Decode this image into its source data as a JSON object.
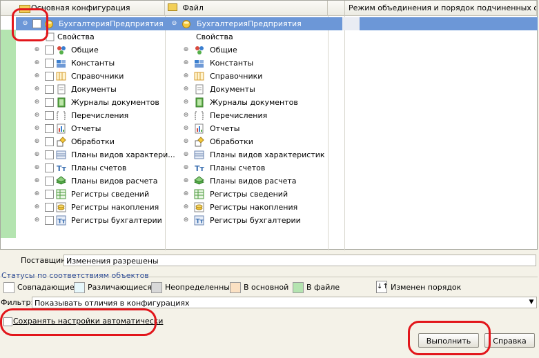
{
  "columns": {
    "main": "Основная конфигурация",
    "file": "Файл",
    "mode": "Режим объединения и порядок подчиненных объе..."
  },
  "root": {
    "left": "БухгалтерияПредприятия",
    "right": "БухгалтерияПредприятия"
  },
  "items": [
    {
      "left": "Свойства",
      "right": "Свойства",
      "icon": "properties-icon"
    },
    {
      "left": "Общие",
      "right": "Общие",
      "icon": "common-icon"
    },
    {
      "left": "Константы",
      "right": "Константы",
      "icon": "constants-icon"
    },
    {
      "left": "Справочники",
      "right": "Справочники",
      "icon": "catalogs-icon"
    },
    {
      "left": "Документы",
      "right": "Документы",
      "icon": "documents-icon"
    },
    {
      "left": "Журналы документов",
      "right": "Журналы документов",
      "icon": "journals-icon"
    },
    {
      "left": "Перечисления",
      "right": "Перечисления",
      "icon": "enums-icon"
    },
    {
      "left": "Отчеты",
      "right": "Отчеты",
      "icon": "reports-icon"
    },
    {
      "left": "Обработки",
      "right": "Обработки",
      "icon": "processing-icon"
    },
    {
      "left": "Планы видов характери...",
      "right": "Планы видов характеристик",
      "icon": "characteristics-icon"
    },
    {
      "left": "Планы счетов",
      "right": "Планы счетов",
      "icon": "accounts-icon"
    },
    {
      "left": "Планы видов расчета",
      "right": "Планы видов расчета",
      "icon": "calculation-icon"
    },
    {
      "left": "Регистры сведений",
      "right": "Регистры сведений",
      "icon": "info-registers-icon"
    },
    {
      "left": "Регистры накопления",
      "right": "Регистры накопления",
      "icon": "accum-registers-icon"
    },
    {
      "left": "Регистры бухгалтерии",
      "right": "Регистры бухгалтерии",
      "icon": "accounting-registers-icon"
    }
  ],
  "supplier": {
    "label": "Поставщик:",
    "value": "Изменения разрешены"
  },
  "statuses": {
    "title": "Статусы по соответствиям объектов",
    "items": [
      {
        "label": "Совпадающие",
        "color": "#ffffff"
      },
      {
        "label": "Различающиеся",
        "color": "#e6f7fb"
      },
      {
        "label": "Неопределенные",
        "color": "#d8d8d8"
      },
      {
        "label": "В основной",
        "color": "#fbe1c3"
      },
      {
        "label": "В файле",
        "color": "#b4e4b0"
      }
    ],
    "order_changed": "Изменен порядок"
  },
  "filter": {
    "label": "Фильтр:",
    "value": "Показывать отличия в конфигурациях"
  },
  "save_settings": "Сохранять настройки автоматически",
  "buttons": {
    "run": "Выполнить",
    "help": "Справка"
  }
}
